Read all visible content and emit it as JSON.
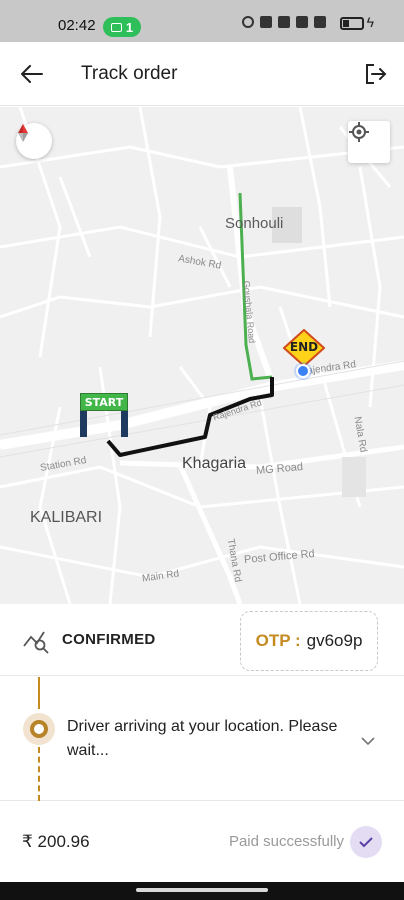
{
  "status_bar": {
    "time": "02:42",
    "pill_count": "1"
  },
  "header": {
    "title": "Track order",
    "back_icon": "arrow-left-icon",
    "exit_icon": "logout-icon"
  },
  "map": {
    "places": {
      "sonhouli": "Sonhouli",
      "khagaria": "Khagaria",
      "kalibari": "KALIBARI"
    },
    "roads": {
      "ashok_rd": "Ashok Rd",
      "station_rd": "Station Rd",
      "mg_road": "MG Road",
      "thana_rd": "Thana Rd",
      "post_office_rd": "Post Office Rd",
      "main_rd": "Main Rd",
      "nala_rd": "Nala Rd",
      "rajendra_rd": "Rajendra Rd",
      "goushala_rd": "Goushala Road",
      "rajendra_rd_2": "Rajendra Rd"
    },
    "start_label": "START",
    "end_label": "END",
    "route_colors": {
      "travelled": "#111111",
      "remaining": "#4caf50"
    }
  },
  "status": {
    "label": "CONFIRMED"
  },
  "otp": {
    "label": "OTP :",
    "value": "gv6o9p"
  },
  "driver": {
    "message": "Driver arriving at your location. Please wait..."
  },
  "payment": {
    "amount": "₹ 200.96",
    "status": "Paid successfully"
  }
}
